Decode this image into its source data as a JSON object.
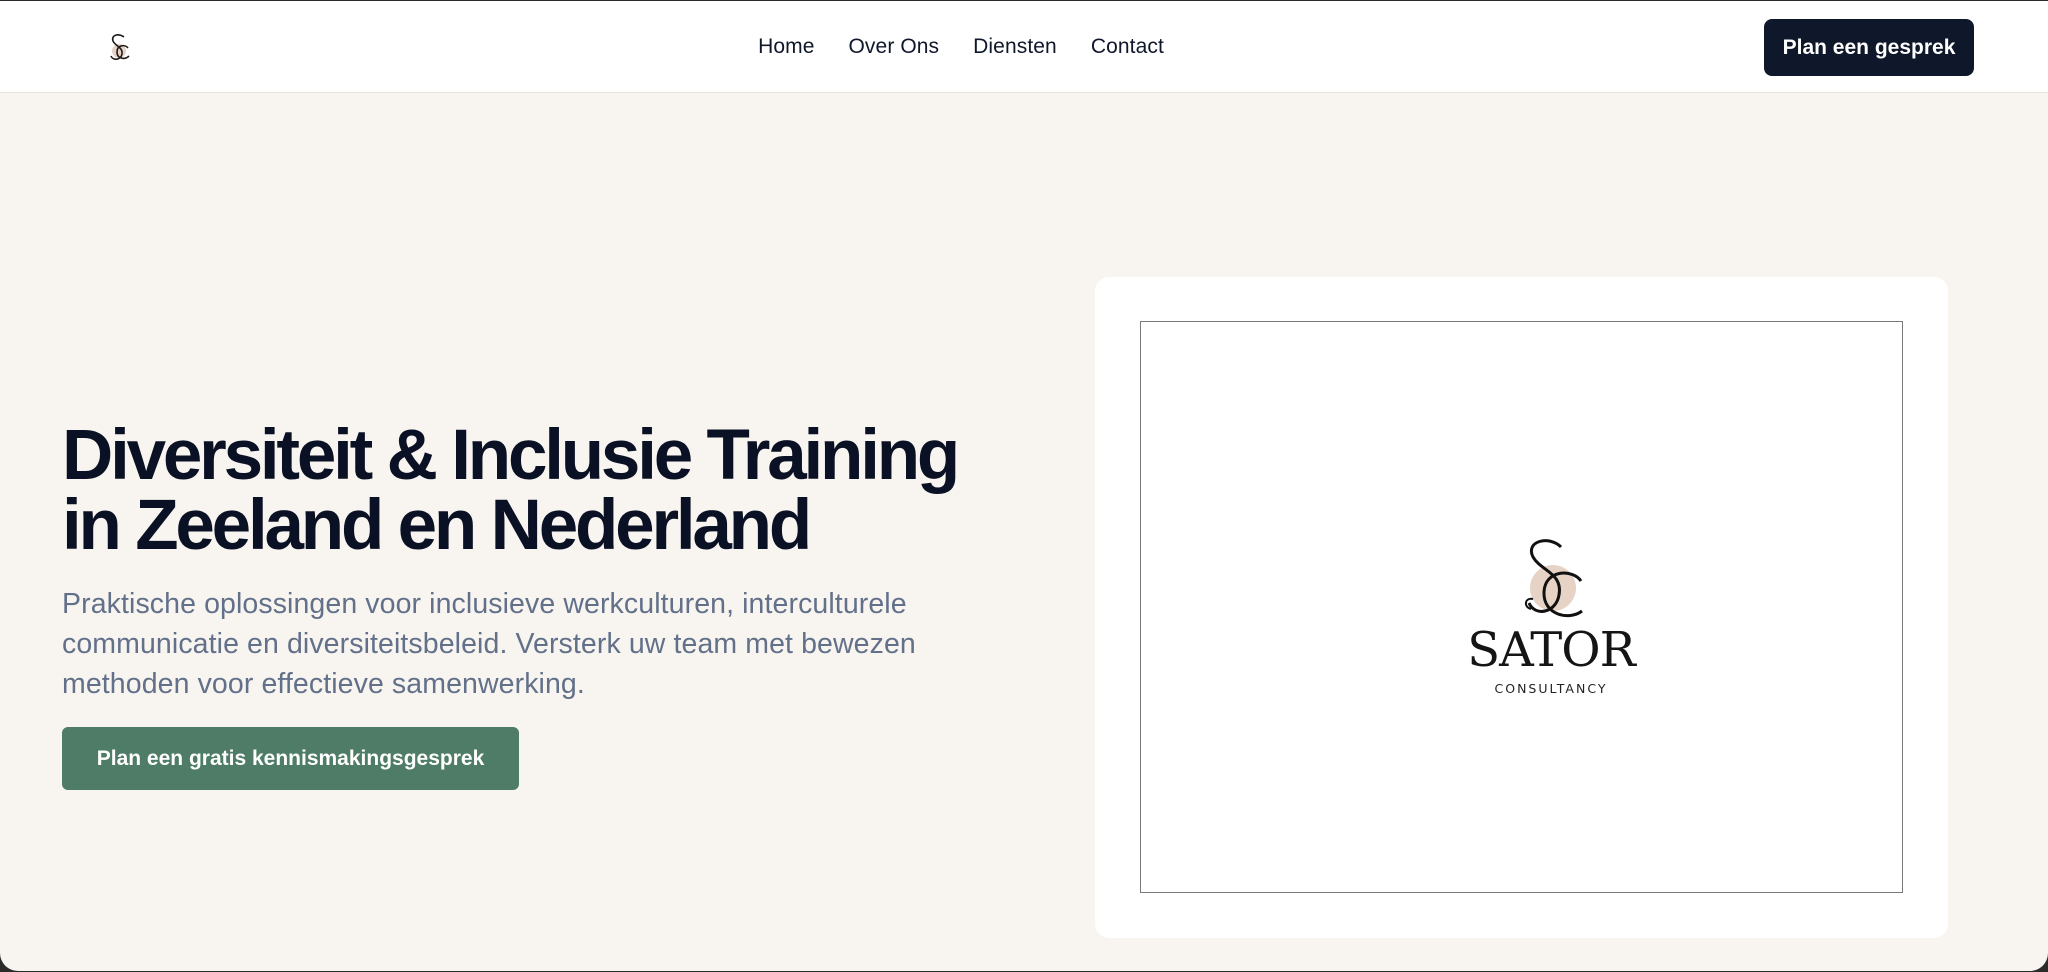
{
  "header": {
    "nav": [
      "Home",
      "Over Ons",
      "Diensten",
      "Contact"
    ],
    "cta_label": "Plan een gesprek"
  },
  "hero": {
    "title": "Diversiteit & Inclusie Training in Zeeland en Nederland",
    "subtitle": "Praktische oplossingen voor inclusieve werkculturen, interculturele communicatie en diversiteitsbeleid. Versterk uw team met bewezen methoden voor effectieve samenwerking.",
    "cta_label": "Plan een gratis kennismakingsgesprek"
  },
  "brand": {
    "name": "SATOR",
    "tagline": "CONSULTANCY"
  },
  "colors": {
    "page_bg": "#f8f5f1",
    "navy": "#0f172a",
    "green": "#4e7c66",
    "muted_text": "#627089",
    "accent_circle": "#e7d3c5"
  }
}
